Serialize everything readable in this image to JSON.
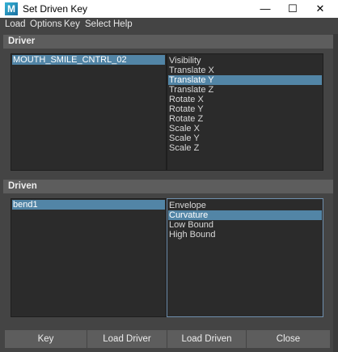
{
  "window": {
    "title": "Set Driven Key",
    "icon_letter": "M",
    "minimize": "—",
    "maximize": "☐",
    "close": "✕"
  },
  "menu": [
    "Load",
    "Options",
    "Key",
    "Select",
    "Help"
  ],
  "driver": {
    "header": "Driver",
    "objects": [
      "MOUTH_SMILE_CNTRL_02"
    ],
    "selected_object": 0,
    "attributes": [
      "Visibility",
      "Translate X",
      "Translate Y",
      "Translate Z",
      "Rotate X",
      "Rotate Y",
      "Rotate Z",
      "Scale X",
      "Scale Y",
      "Scale Z"
    ],
    "selected_attribute": 2
  },
  "driven": {
    "header": "Driven",
    "objects": [
      "bend1"
    ],
    "selected_object": 0,
    "attributes": [
      "Envelope",
      "Curvature",
      "Low Bound",
      "High Bound"
    ],
    "selected_attribute": 1
  },
  "buttons": {
    "key": "Key",
    "load_driver": "Load Driver",
    "load_driven": "Load Driven",
    "close": "Close"
  },
  "colors": {
    "selection": "#5285a6",
    "panel": "#2b2b2b",
    "background": "#444444"
  }
}
